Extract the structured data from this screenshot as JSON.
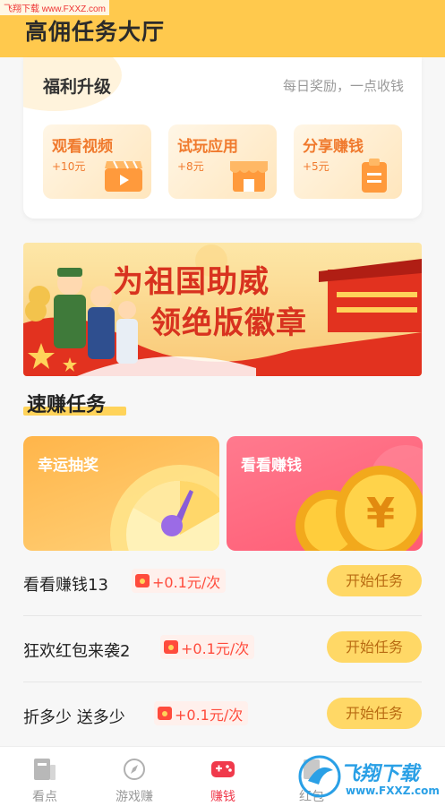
{
  "watermark": {
    "site": "飞翔下载 www.FXXZ.com",
    "logo_text": "飞翔下载",
    "logo_url": "www.FXXZ.com"
  },
  "header": {
    "title": "高佣任务大厅"
  },
  "welfare": {
    "title": "福利升级",
    "subtitle": "每日奖励，一点收钱",
    "cards": [
      {
        "label": "观看视频",
        "value": "+10元",
        "icon": "video-clapper-icon"
      },
      {
        "label": "试玩应用",
        "value": "+8元",
        "icon": "shop-icon"
      },
      {
        "label": "分享赚钱",
        "value": "+5元",
        "icon": "clipboard-icon"
      }
    ]
  },
  "banner": {
    "line1": "为祖国助威",
    "line2": "领绝版徽章"
  },
  "quick": {
    "title": "速赚任务",
    "cards": [
      {
        "label": "幸运抽奖",
        "icon": "lucky-wheel-icon"
      },
      {
        "label": "看看赚钱",
        "icon": "gold-coin-icon"
      }
    ]
  },
  "tasks": [
    {
      "name": "看看赚钱13",
      "reward": "+0.1元/次",
      "button": "开始任务"
    },
    {
      "name": "狂欢红包来袭2",
      "reward": "+0.1元/次",
      "button": "开始任务"
    },
    {
      "name": "折多少 送多少",
      "reward": "+0.1元/次",
      "button": "开始任务"
    }
  ],
  "tabbar": {
    "items": [
      {
        "label": "看点",
        "icon": "news-icon"
      },
      {
        "label": "游戏赚",
        "icon": "compass-icon"
      },
      {
        "label": "赚钱",
        "icon": "gamepad-icon",
        "active": true
      },
      {
        "label": "红包",
        "icon": "red-packet-icon"
      }
    ]
  },
  "colors": {
    "header": "#ffc94d",
    "accent": "#f07a2e",
    "active_tab": "#f03a4c",
    "reward": "#ff4b3c",
    "button": "#ffd866"
  }
}
